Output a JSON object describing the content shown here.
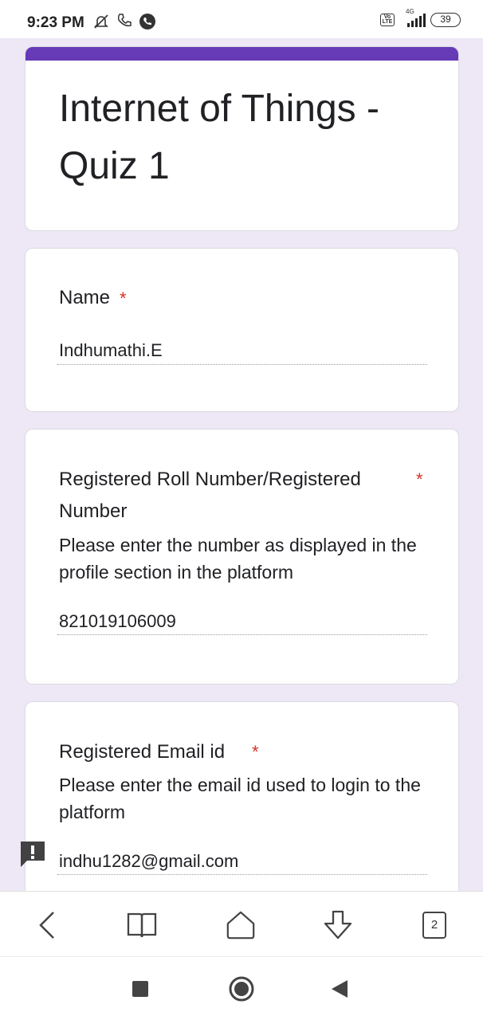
{
  "status_bar": {
    "time": "9:23 PM",
    "network": "4G",
    "battery": "39",
    "icons": [
      "bell-off-icon",
      "phone-icon",
      "whatsapp-icon",
      "volte-icon",
      "signal-icon",
      "battery-icon"
    ]
  },
  "form": {
    "title": "Internet of Things - Quiz 1",
    "accent_color": "#673ab7",
    "background_color": "#ede7f6",
    "required_marker": "*",
    "required_color": "#d93025"
  },
  "questions": [
    {
      "label": "Name",
      "description": "",
      "answer": "Indhumathi.E"
    },
    {
      "label_line1": "Registered Roll Number/Registered",
      "label_line2": "Number",
      "description": "Please enter the number as displayed in the profile section in the platform",
      "answer": "821019106009"
    },
    {
      "label": "Registered Email id",
      "description": "Please enter the email id used to login to the platform",
      "answer": "indhu1282@gmail.com"
    }
  ],
  "browser_bar": {
    "tab_count": "2",
    "icons": [
      "back-icon",
      "bookmarks-icon",
      "home-icon",
      "download-icon",
      "tabs-icon"
    ]
  },
  "system_nav": {
    "icons": [
      "recents-icon",
      "home-icon",
      "back-icon"
    ]
  }
}
